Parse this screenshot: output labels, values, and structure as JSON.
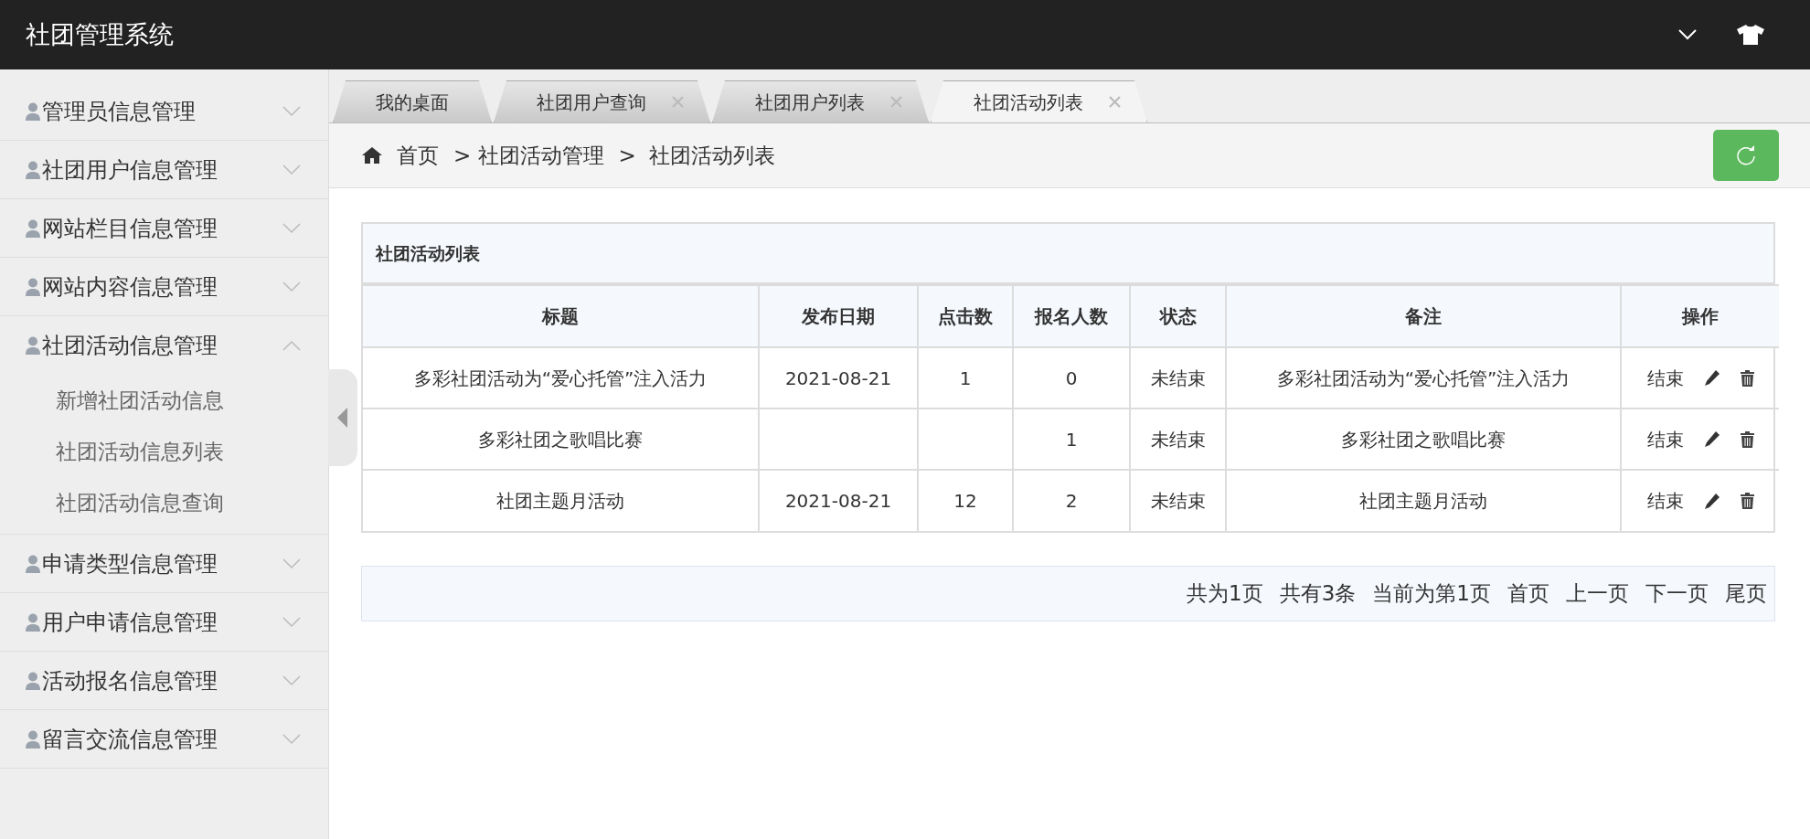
{
  "header": {
    "title": "社团管理系统"
  },
  "sidebar": {
    "items": [
      {
        "label": "管理员信息管理",
        "expanded": false
      },
      {
        "label": "社团用户信息管理",
        "expanded": false
      },
      {
        "label": "网站栏目信息管理",
        "expanded": false
      },
      {
        "label": "网站内容信息管理",
        "expanded": false
      },
      {
        "label": "社团活动信息管理",
        "expanded": true,
        "children": [
          {
            "label": "新增社团活动信息"
          },
          {
            "label": "社团活动信息列表"
          },
          {
            "label": "社团活动信息查询"
          }
        ]
      },
      {
        "label": "申请类型信息管理",
        "expanded": false
      },
      {
        "label": "用户申请信息管理",
        "expanded": false
      },
      {
        "label": "活动报名信息管理",
        "expanded": false
      },
      {
        "label": "留言交流信息管理",
        "expanded": false
      }
    ]
  },
  "tabs": [
    {
      "label": "我的桌面",
      "selected": false,
      "closable": false
    },
    {
      "label": "社团用户查询",
      "selected": false,
      "closable": true
    },
    {
      "label": "社团用户列表",
      "selected": false,
      "closable": true
    },
    {
      "label": "社团活动列表",
      "selected": true,
      "closable": true
    }
  ],
  "breadcrumb": [
    "首页",
    "> 社团活动管理",
    ">  社团活动列表"
  ],
  "table": {
    "title": "社团活动列表",
    "columns": [
      "标题",
      "发布日期",
      "点击数",
      "报名人数",
      "状态",
      "备注",
      "操作"
    ],
    "rows": [
      {
        "cells": [
          "多彩社团活动为“爱心托管”注入活力",
          "2021-08-21",
          "1",
          "0",
          "未结束",
          "多彩社团活动为“爱心托管”注入活力"
        ],
        "action": "结束"
      },
      {
        "cells": [
          "多彩社团之歌唱比赛",
          "",
          "",
          "1",
          "未结束",
          "多彩社团之歌唱比赛"
        ],
        "action": "结束"
      },
      {
        "cells": [
          "社团主题月活动",
          "2021-08-21",
          "12",
          "2",
          "未结束",
          "社团主题月活动"
        ],
        "action": "结束"
      }
    ]
  },
  "pagination": [
    "共为1页",
    "共有3条",
    "当前为第1页",
    "首页",
    "上一页",
    "下一页",
    "尾页"
  ]
}
